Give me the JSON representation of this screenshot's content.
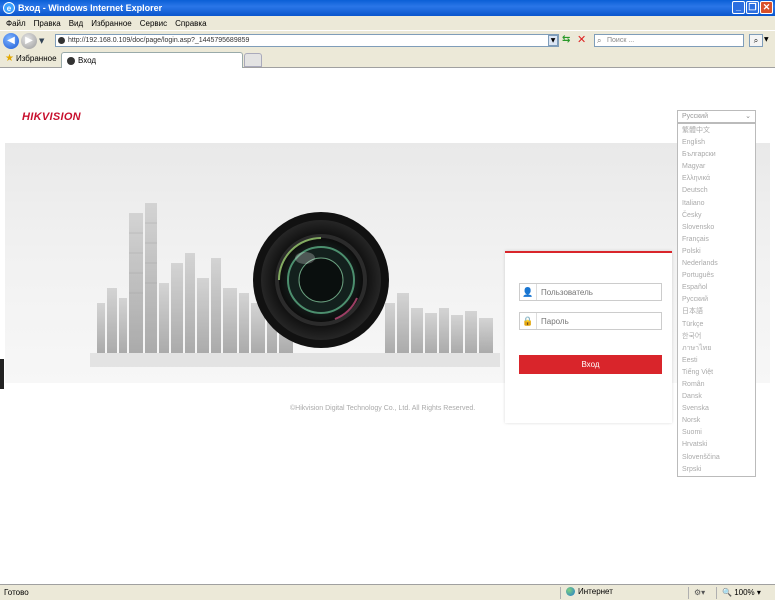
{
  "window": {
    "title": "Вход - Windows Internet Explorer",
    "buttons": [
      "_",
      "❐",
      "✕"
    ]
  },
  "menu": [
    "Файл",
    "Правка",
    "Вид",
    "Избранное",
    "Сервис",
    "Справка"
  ],
  "address": {
    "url": "http://192.168.0.109/doc/page/login.asp?_1445795689859",
    "search_placeholder": "Поиск ..."
  },
  "favorites_label": "Избранное",
  "tab_title": "Вход",
  "page": {
    "brand": "HIKVISION",
    "username_placeholder": "Пользователь",
    "password_placeholder": "Пароль",
    "login_button": "Вход",
    "footer": "©Hikvision Digital Technology Co., Ltd. All Rights Reserved.",
    "language_selected": "Русский",
    "languages": [
      "繁體中文",
      "English",
      "Български",
      "Magyar",
      "Ελληνικά",
      "Deutsch",
      "Italiano",
      "Česky",
      "Slovensko",
      "Français",
      "Polski",
      "Nederlands",
      "Português",
      "Español",
      "Русский",
      "日本語",
      "Türkçe",
      "한국어",
      "ภาษาไทย",
      "Eesti",
      "Tiếng Việt",
      "Român",
      "Dansk",
      "Svenska",
      "Norsk",
      "Suomi",
      "Hrvatski",
      "Slovenščina",
      "Srpski"
    ]
  },
  "status": {
    "text": "Готово",
    "zone": "Интернет",
    "zoom": "100%"
  },
  "colors": {
    "accent": "#d9252b",
    "brand": "#c8102e"
  }
}
